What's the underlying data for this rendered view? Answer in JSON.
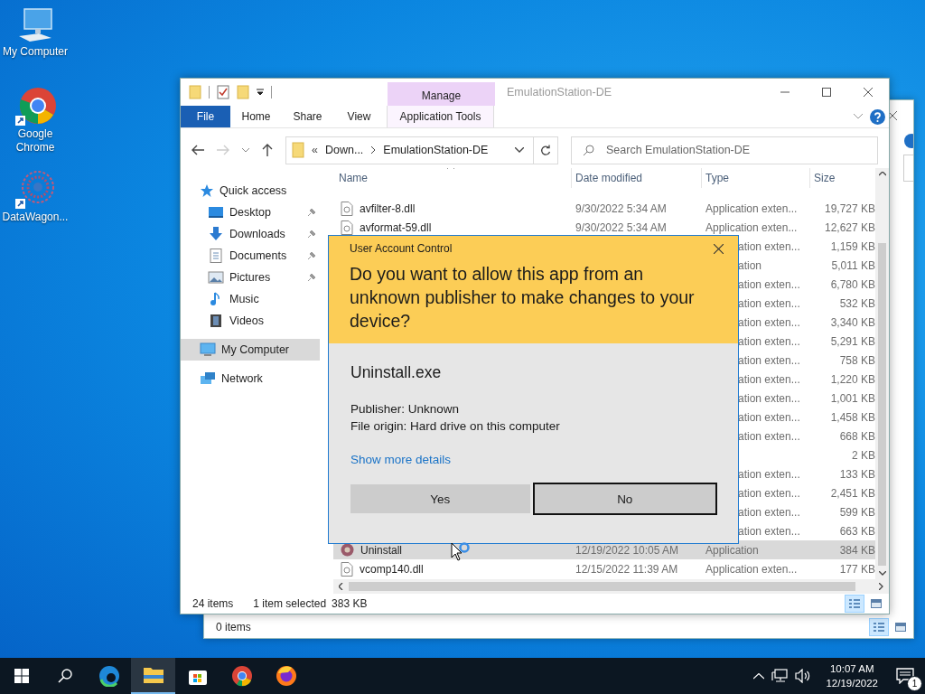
{
  "desktop_icons": [
    {
      "label": "My Computer"
    },
    {
      "label": "Google Chrome"
    },
    {
      "label": "DataWagon..."
    }
  ],
  "back_window": {
    "status": "0 items",
    "views": [
      {
        "selected": true
      },
      {
        "selected": false
      }
    ]
  },
  "explorer": {
    "title": "EmulationStation-DE",
    "context_tab": "Manage",
    "ribbon_tabs": [
      {
        "label": "File",
        "kind": "file",
        "selected": false
      },
      {
        "label": "Home",
        "kind": "plain",
        "selected": false
      },
      {
        "label": "Share",
        "kind": "plain",
        "selected": false
      },
      {
        "label": "View",
        "kind": "plain",
        "selected": false
      },
      {
        "label": "Application Tools",
        "kind": "context",
        "selected": false
      }
    ],
    "address": {
      "overflow": "«",
      "crumbs": [
        "Down...",
        "EmulationStation-DE"
      ]
    },
    "search": {
      "placeholder": "Search EmulationStation-DE"
    },
    "nav": [
      {
        "label": "Quick access",
        "selected": false,
        "children": [
          {
            "label": "Desktop",
            "pinned": true,
            "selected": false
          },
          {
            "label": "Downloads",
            "pinned": true,
            "selected": false
          },
          {
            "label": "Documents",
            "pinned": true,
            "selected": false
          },
          {
            "label": "Pictures",
            "pinned": true,
            "selected": false
          },
          {
            "label": "Music",
            "pinned": false,
            "selected": false
          },
          {
            "label": "Videos",
            "pinned": false,
            "selected": false
          }
        ]
      },
      {
        "label": "My Computer",
        "selected": true
      },
      {
        "label": "Network",
        "selected": false
      }
    ],
    "columns": [
      "Name",
      "Date modified",
      "Type",
      "Size"
    ],
    "rows": [
      {
        "kind": "dll",
        "name": "avfilter-8.dll",
        "date": "9/30/2022 5:34 AM",
        "type": "Application exten...",
        "size": "19,727 KB",
        "selected": false
      },
      {
        "kind": "dll",
        "name": "avformat-59.dll",
        "date": "9/30/2022 5:34 AM",
        "type": "Application exten...",
        "size": "12,627 KB",
        "selected": false
      },
      {
        "kind": "covered",
        "type": "ation exten...",
        "size": "1,159 KB",
        "selected": false
      },
      {
        "kind": "covered",
        "type": "ation",
        "size": "5,011 KB",
        "selected": false
      },
      {
        "kind": "covered",
        "type": "ation exten...",
        "size": "6,780 KB",
        "selected": false
      },
      {
        "kind": "covered",
        "type": "ation exten...",
        "size": "532 KB",
        "selected": false
      },
      {
        "kind": "covered",
        "type": "ation exten...",
        "size": "3,340 KB",
        "selected": false
      },
      {
        "kind": "covered",
        "type": "ation exten...",
        "size": "5,291 KB",
        "selected": false
      },
      {
        "kind": "covered",
        "type": "ation exten...",
        "size": "758 KB",
        "selected": false
      },
      {
        "kind": "covered",
        "type": "ation exten...",
        "size": "1,220 KB",
        "selected": false
      },
      {
        "kind": "covered",
        "type": "ation exten...",
        "size": "1,001 KB",
        "selected": false
      },
      {
        "kind": "covered",
        "type": "ation exten...",
        "size": "1,458 KB",
        "selected": false
      },
      {
        "kind": "covered",
        "type": "ation exten...",
        "size": "668 KB",
        "selected": false
      },
      {
        "kind": "covered",
        "size": "2 KB",
        "selected": false
      },
      {
        "kind": "covered",
        "type": "ation exten...",
        "size": "133 KB",
        "selected": false
      },
      {
        "kind": "covered",
        "type": "ation exten...",
        "size": "2,451 KB",
        "selected": false
      },
      {
        "kind": "covered",
        "type": "ation exten...",
        "size": "599 KB",
        "selected": false
      },
      {
        "kind": "covered",
        "type": "ation exten...",
        "size": "663 KB",
        "selected": false
      },
      {
        "kind": "app",
        "name": "Uninstall",
        "date": "12/19/2022 10:05 AM",
        "type": "Application",
        "size": "384 KB",
        "selected": true
      },
      {
        "kind": "dll",
        "name": "vcomp140.dll",
        "date": "12/15/2022 11:39 AM",
        "type": "Application exten...",
        "size": "177 KB",
        "selected": false
      }
    ],
    "status": {
      "count": "24 items",
      "selection": "1 item selected",
      "size": "383 KB"
    },
    "views": [
      {
        "selected": true
      },
      {
        "selected": false
      }
    ]
  },
  "uac": {
    "caption": "User Account Control",
    "question": "Do you want to allow this app from an unknown publisher to make changes to your device?",
    "program": "Uninstall.exe",
    "details": [
      "Publisher: Unknown",
      "File origin: Hard drive on this computer"
    ],
    "link": "Show more details",
    "buttons": [
      {
        "label": "Yes",
        "focused": false
      },
      {
        "label": "No",
        "focused": true
      }
    ]
  },
  "taskbar": {
    "apps": [
      {
        "selected": false
      },
      {
        "selected": true
      },
      {
        "selected": false
      },
      {
        "selected": false
      },
      {
        "selected": false
      }
    ],
    "time": "10:07 AM",
    "date": "12/19/2022",
    "notifications": "1"
  }
}
